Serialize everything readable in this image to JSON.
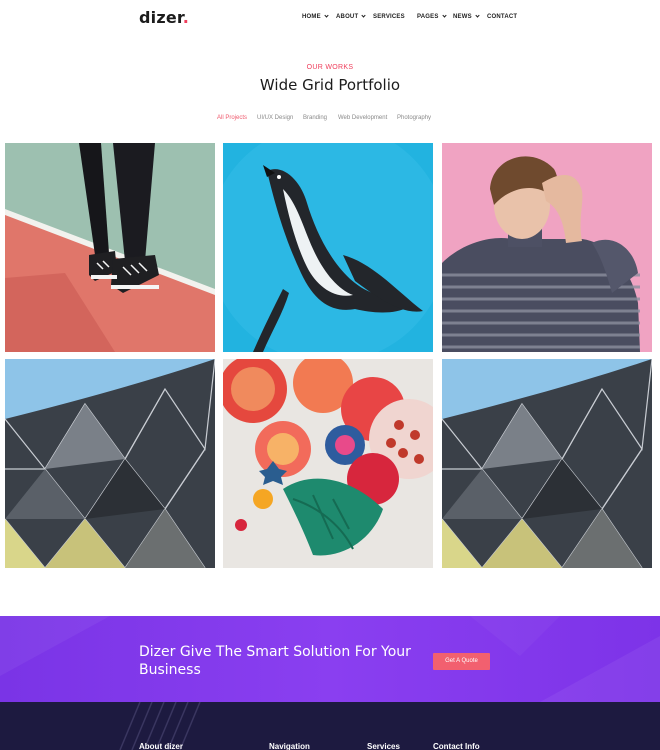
{
  "brand": {
    "name": "dizer",
    "dot": ".",
    "accent": "#ef3e5c"
  },
  "nav": {
    "items": [
      {
        "label": "HOME",
        "dropdown": true
      },
      {
        "label": "ABOUT",
        "dropdown": true
      },
      {
        "label": "SERVICES",
        "dropdown": false
      },
      {
        "label": "PAGES",
        "dropdown": true
      },
      {
        "label": "NEWS",
        "dropdown": true
      },
      {
        "label": "CONTACT",
        "dropdown": false
      }
    ]
  },
  "portfolio": {
    "eyebrow": "OUR WORKS",
    "title": "Wide Grid Portfolio",
    "filters": [
      {
        "label": "All Projects",
        "active": true
      },
      {
        "label": "UI/UX Design",
        "active": false
      },
      {
        "label": "Branding",
        "active": false
      },
      {
        "label": "Web Development",
        "active": false
      },
      {
        "label": "Photography",
        "active": false
      }
    ],
    "items": [
      {
        "image": "sneakers-on-court-photo"
      },
      {
        "image": "penguin-underwater-photo"
      },
      {
        "image": "young-man-pink-wall-photo"
      },
      {
        "image": "geometric-building-facade-photo"
      },
      {
        "image": "colorful-paper-art-photo"
      },
      {
        "image": "geometric-building-facade-photo"
      }
    ]
  },
  "cta": {
    "text": "Dizer Give The Smart Solution For Your Business",
    "button_label": "Get A Quote",
    "background": "#7a34e6",
    "button_color": "#f2606f"
  },
  "footer": {
    "background": "#1d1a40",
    "headings": [
      "About dizer",
      "Navigation",
      "Services",
      "Contact Info"
    ]
  }
}
